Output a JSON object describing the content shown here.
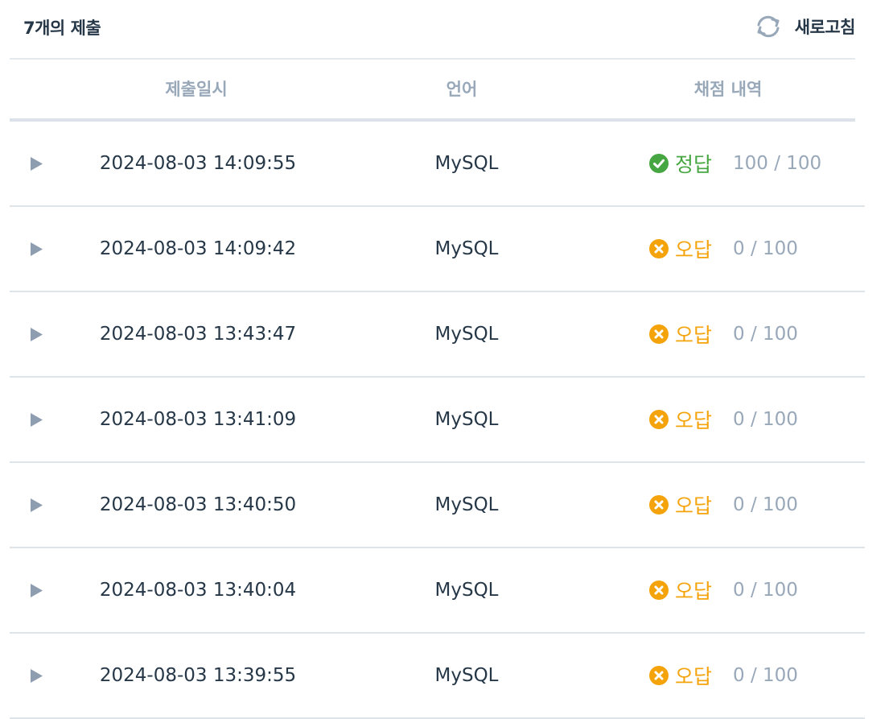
{
  "header": {
    "count_title": "7개의 제출",
    "refresh_label": "새로고침",
    "refresh_icon": "refresh-icon"
  },
  "table": {
    "columns": [
      "제출일시",
      "언어",
      "채점 내역"
    ],
    "rows": [
      {
        "datetime": "2024-08-03 14:09:55",
        "language": "MySQL",
        "status": "정답",
        "status_kind": "correct",
        "score": "100 / 100"
      },
      {
        "datetime": "2024-08-03 14:09:42",
        "language": "MySQL",
        "status": "오답",
        "status_kind": "wrong",
        "score": "0 / 100"
      },
      {
        "datetime": "2024-08-03 13:43:47",
        "language": "MySQL",
        "status": "오답",
        "status_kind": "wrong",
        "score": "0 / 100"
      },
      {
        "datetime": "2024-08-03 13:41:09",
        "language": "MySQL",
        "status": "오답",
        "status_kind": "wrong",
        "score": "0 / 100"
      },
      {
        "datetime": "2024-08-03 13:40:50",
        "language": "MySQL",
        "status": "오답",
        "status_kind": "wrong",
        "score": "0 / 100"
      },
      {
        "datetime": "2024-08-03 13:40:04",
        "language": "MySQL",
        "status": "오답",
        "status_kind": "wrong",
        "score": "0 / 100"
      },
      {
        "datetime": "2024-08-03 13:39:55",
        "language": "MySQL",
        "status": "오답",
        "status_kind": "wrong",
        "score": "0 / 100"
      }
    ]
  },
  "colors": {
    "correct": "#46a641",
    "wrong": "#f5a30b",
    "muted": "#98a8b9",
    "text": "#263747"
  }
}
